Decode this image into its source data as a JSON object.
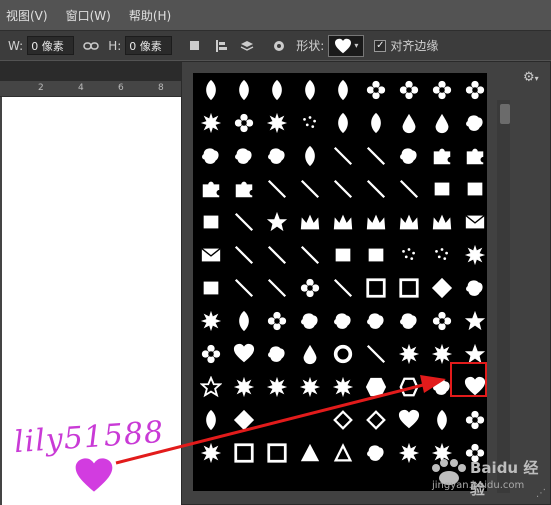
{
  "menubar": {
    "items": [
      "视图(V)",
      "窗口(W)",
      "帮助(H)"
    ]
  },
  "options": {
    "w_label": "W:",
    "w_value": "0 像素",
    "h_label": "H:",
    "h_value": "0 像素",
    "shape_label": "形状:",
    "align_label": "对齐边缘",
    "align_checked": true
  },
  "ruler": {
    "ticks": [
      "2",
      "4",
      "6",
      "8"
    ]
  },
  "shapes_panel": {
    "rows": 12,
    "columns": 9,
    "selected_row": 9,
    "selected_column": 9,
    "selected_shape": "heart-icon"
  },
  "annotation": {
    "signature": "lily51588",
    "color": "#c93ad6",
    "highlight_color": "#e21b1b"
  },
  "watermark": {
    "name": "Baidu 经验",
    "url": "jingyan.baidu.com"
  }
}
